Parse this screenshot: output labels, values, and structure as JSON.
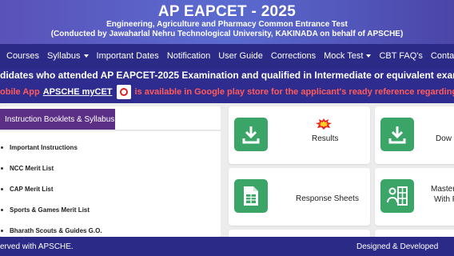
{
  "header": {
    "title": "AP EAPCET - 2025",
    "subtitle": "Engineering, Agriculture and Pharmacy Common Entrance Test",
    "conducted_by": "(Conducted by Jawaharlal Nehru Technological University, KAKINADA on behalf of APSCHE)"
  },
  "nav": {
    "items": [
      "Courses",
      "Syllabus",
      "Important Dates",
      "Notification",
      "User Guide",
      "Corrections",
      "Mock Test",
      "CBT FAQ's",
      "Contact Us"
    ]
  },
  "ticker": {
    "line1": "didates who attended AP EAPCET-2025 Examination and qualified in Intermediate or equivalent examination have to fill",
    "line2_prefix": "obile App",
    "line2_link": "APSCHE myCET",
    "line2_suffix": "is available in Google play store for the applicant's ready reference regarding CET related"
  },
  "instructions": {
    "tab": "Instruction Booklets & Syllabus",
    "items": [
      "Important Instructions",
      "NCC Merit List",
      "CAP Merit List",
      "Sports & Games Merit List",
      "Bharath Scouts & Guides G.O."
    ]
  },
  "cards": {
    "results": "Results",
    "download": "Dow",
    "response_sheets": "Response Sheets",
    "master_line1": "Master",
    "master_line2": "With F"
  },
  "footer": {
    "left": "erved with APSCHE.",
    "right": "Designed & Developed"
  },
  "colors": {
    "nav_bg": "#2c2a87",
    "header_bg": "#5a52b8",
    "tab_bg": "#5c2f86",
    "icon_green": "#3aa567",
    "ticker_red": "#ff5a5a"
  }
}
